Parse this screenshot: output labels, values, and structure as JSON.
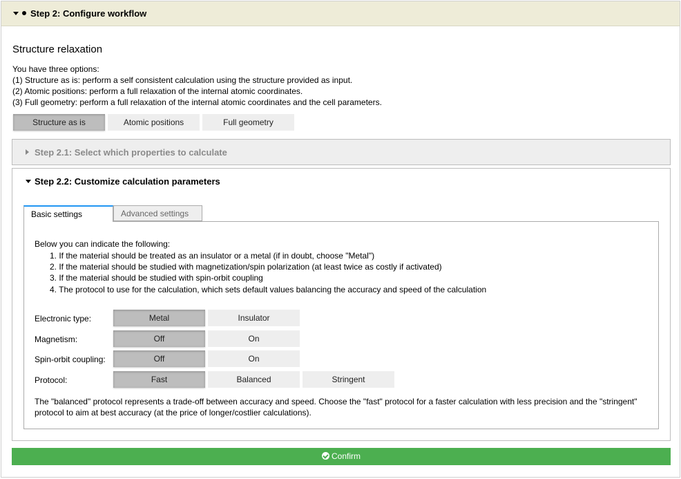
{
  "step2": {
    "title": "Step 2: Configure workflow"
  },
  "relaxation": {
    "title": "Structure relaxation",
    "intro": "You have three options:",
    "options": [
      "(1) Structure as is: perform a self consistent calculation using the structure provided as input.",
      "(2) Atomic positions: perform a full relaxation of the internal atomic coordinates.",
      "(3) Full geometry: perform a full relaxation of the internal atomic coordinates and the cell parameters."
    ],
    "buttons": [
      "Structure as is",
      "Atomic positions",
      "Full geometry"
    ],
    "selected": "Structure as is"
  },
  "step21": {
    "title": "Step 2.1: Select which properties to calculate"
  },
  "step22": {
    "title": "Step 2.2: Customize calculation parameters",
    "tabs": [
      "Basic settings",
      "Advanced settings"
    ],
    "active_tab": "Basic settings",
    "intro": "Below you can indicate the following:",
    "list": [
      "1. If the material should be treated as an insulator or a metal (if in doubt, choose \"Metal\")",
      "2. If the material should be studied with magnetization/spin polarization (at least twice as costly if activated)",
      "3. If the material should be studied with spin-orbit coupling",
      "4. The protocol to use for the calculation, which sets default values balancing the accuracy and speed of the calculation"
    ],
    "electronic_type": {
      "label": "Electronic type:",
      "options": [
        "Metal",
        "Insulator"
      ],
      "selected": "Metal"
    },
    "magnetism": {
      "label": "Magnetism:",
      "options": [
        "Off",
        "On"
      ],
      "selected": "Off"
    },
    "spin_orbit": {
      "label": "Spin-orbit coupling:",
      "options": [
        "Off",
        "On"
      ],
      "selected": "Off"
    },
    "protocol": {
      "label": "Protocol:",
      "options": [
        "Fast",
        "Balanced",
        "Stringent"
      ],
      "selected": "Fast"
    },
    "note_line1": "The \"balanced\" protocol represents a trade-off between accuracy and speed. Choose the \"fast\" protocol for a faster calculation with less precision and the \"stringent\"",
    "note_line2": "protocol to aim at best accuracy (at the price of longer/costlier calculations)."
  },
  "confirm": {
    "label": "Confirm",
    "icon": "check-circle-icon",
    "color": "#4caf50"
  }
}
